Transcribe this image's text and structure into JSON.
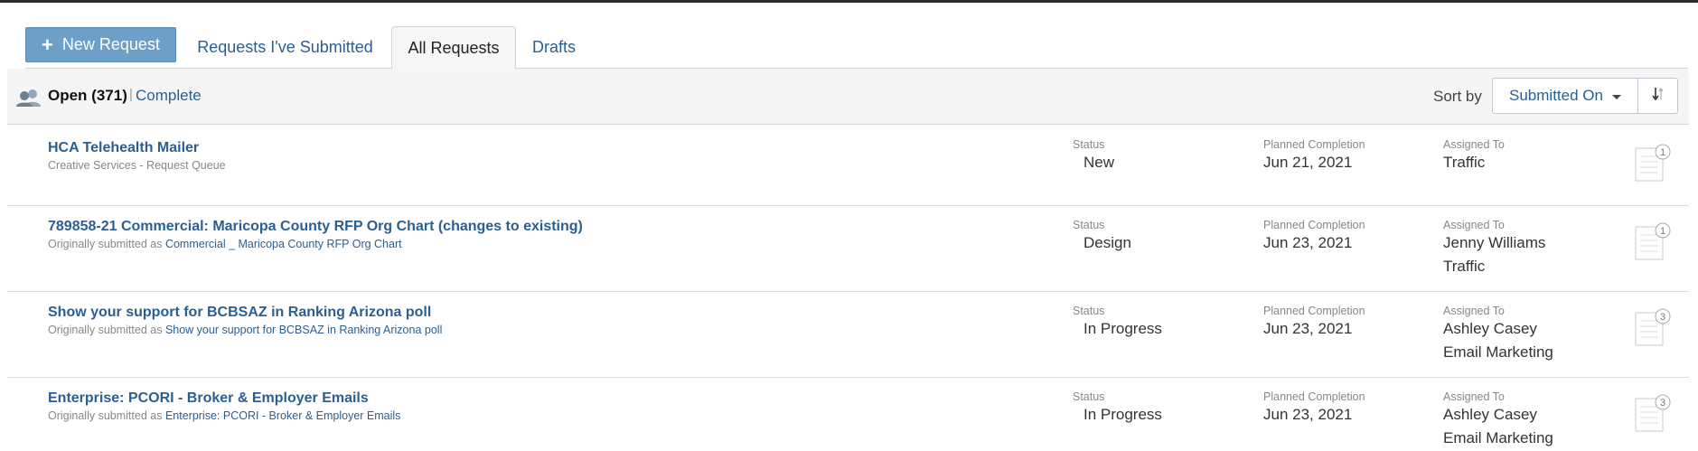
{
  "tabs": {
    "new_request": "New Request",
    "submitted": "Requests I've Submitted",
    "all": "All Requests",
    "drafts": "Drafts"
  },
  "toolbar": {
    "open_label": "Open (371)",
    "separator": "|",
    "complete_label": "Complete",
    "sort_by_label": "Sort by",
    "sort_value": "Submitted On"
  },
  "columns": {
    "status": "Status",
    "planned": "Planned Completion",
    "assigned": "Assigned To"
  },
  "rows": [
    {
      "title": "HCA Telehealth Mailer",
      "subtitle_prefix": "Creative Services - Request Queue",
      "subtitle_link": "",
      "status": "New",
      "planned": "Jun 21, 2021",
      "assigned1": "Traffic",
      "assigned2": "",
      "count": "1"
    },
    {
      "title": "789858-21 Commercial: Maricopa County RFP Org Chart (changes to existing)",
      "subtitle_prefix": "Originally submitted as",
      "subtitle_link": "Commercial _ Maricopa County RFP Org Chart",
      "status": "Design",
      "planned": "Jun 23, 2021",
      "assigned1": "Jenny Williams",
      "assigned2": "Traffic",
      "count": "1"
    },
    {
      "title": "Show your support for BCBSAZ in Ranking Arizona poll",
      "subtitle_prefix": "Originally submitted as",
      "subtitle_link": "Show your support for BCBSAZ in Ranking Arizona poll",
      "status": "In Progress",
      "planned": "Jun 23, 2021",
      "assigned1": "Ashley Casey",
      "assigned2": "Email Marketing",
      "count": "3"
    },
    {
      "title": "Enterprise: PCORI - Broker & Employer Emails",
      "subtitle_prefix": "Originally submitted as",
      "subtitle_link": "Enterprise: PCORI - Broker & Employer Emails",
      "status": "In Progress",
      "planned": "Jun 23, 2021",
      "assigned1": "Ashley Casey",
      "assigned2": "Email Marketing",
      "count": "3"
    }
  ],
  "colors": {
    "link": "#2b5f92",
    "primary_button": "#6d9fc8",
    "toolbar_bg": "#f5f5f5"
  },
  "icons": [
    "plus-icon",
    "users-group-icon",
    "caret-down-icon",
    "sort-direction-icon",
    "document-icon"
  ]
}
